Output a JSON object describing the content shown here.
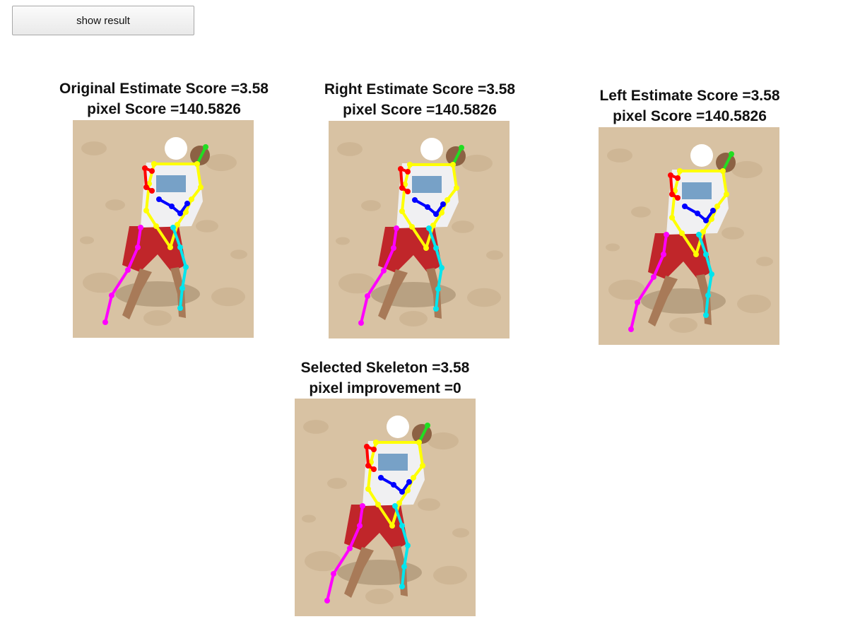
{
  "toolbar": {
    "show_result_label": "show result"
  },
  "panels": [
    {
      "title_line1": "Original Estimate Score =3.58",
      "title_line2": "pixel Score =140.5826"
    },
    {
      "title_line1": "Right Estimate Score =3.58",
      "title_line2": "pixel Score =140.5826"
    },
    {
      "title_line1": "Left Estimate Score =3.58",
      "title_line2": "pixel Score =140.5826"
    },
    {
      "title_line1": "Selected Skeleton =3.58",
      "title_line2": "pixel improvement =0"
    }
  ],
  "colors": {
    "sand": "#d8c2a3",
    "limb_green": "#22dd22",
    "limb_yellow": "#ffff00",
    "limb_red": "#ff0000",
    "limb_blue": "#0000ff",
    "limb_magenta": "#ff00ff",
    "limb_cyan": "#00e5ee"
  }
}
